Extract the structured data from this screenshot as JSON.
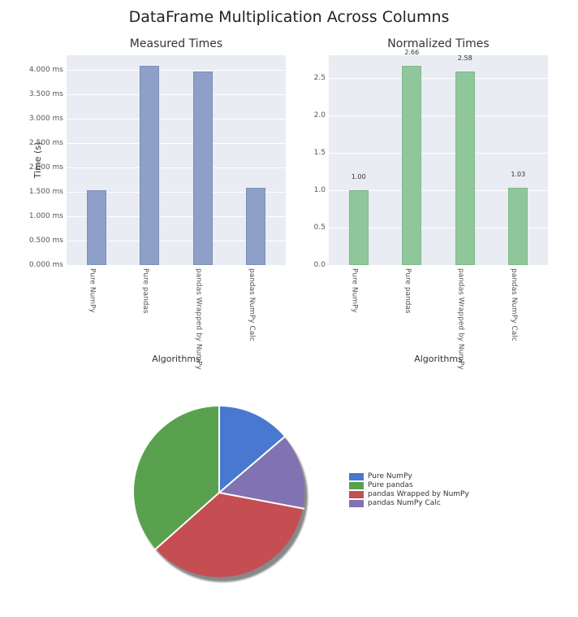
{
  "suptitle": "DataFrame Multiplication Across Columns",
  "left": {
    "title": "Measured Times",
    "ylabel": "Time (s)",
    "xlabel": "Algorithms",
    "yticks": [
      "0.000 ms",
      "0.500 ms",
      "1.000 ms",
      "1.500 ms",
      "2.000 ms",
      "2.500 ms",
      "3.000 ms",
      "3.500 ms",
      "4.000 ms"
    ]
  },
  "right": {
    "title": "Normalized Times",
    "xlabel": "Algorithms",
    "yticks": [
      "0.0",
      "0.5",
      "1.0",
      "1.5",
      "2.0",
      "2.5"
    ],
    "bar_vals": [
      "1.00",
      "2.66",
      "2.58",
      "1.03"
    ]
  },
  "categories": [
    "Pure NumPy",
    "Pure pandas",
    "pandas Wrapped by NumPy",
    "pandas NumPy Calc"
  ],
  "legend": [
    "Pure NumPy",
    "Pure pandas",
    "pandas Wrapped by NumPy",
    "pandas NumPy Calc"
  ],
  "colors": {
    "blue": "#4878cf",
    "green": "#59a削4e",
    "red": "#c44e52",
    "purple": "#8172b2"
  },
  "chart_data": [
    {
      "type": "bar",
      "title": "Measured Times",
      "xlabel": "Algorithms",
      "ylabel": "Time (s)",
      "ylim": [
        0,
        4.3
      ],
      "categories": [
        "Pure NumPy",
        "Pure pandas",
        "pandas Wrapped by NumPy",
        "pandas NumPy Calc"
      ],
      "values_ms": [
        1.54,
        4.09,
        3.97,
        1.59
      ],
      "ytick_format": "{:.3f} ms"
    },
    {
      "type": "bar",
      "title": "Normalized Times",
      "xlabel": "Algorithms",
      "ylabel": "",
      "ylim": [
        0,
        2.8
      ],
      "categories": [
        "Pure NumPy",
        "Pure pandas",
        "pandas Wrapped by NumPy",
        "pandas NumPy Calc"
      ],
      "values": [
        1.0,
        2.66,
        2.58,
        1.03
      ]
    },
    {
      "type": "pie",
      "categories": [
        "Pure NumPy",
        "Pure pandas",
        "pandas Wrapped by NumPy",
        "pandas NumPy Calc"
      ],
      "values": [
        1.54,
        4.09,
        3.97,
        1.59
      ],
      "startangle": 90,
      "shadow": true
    }
  ]
}
